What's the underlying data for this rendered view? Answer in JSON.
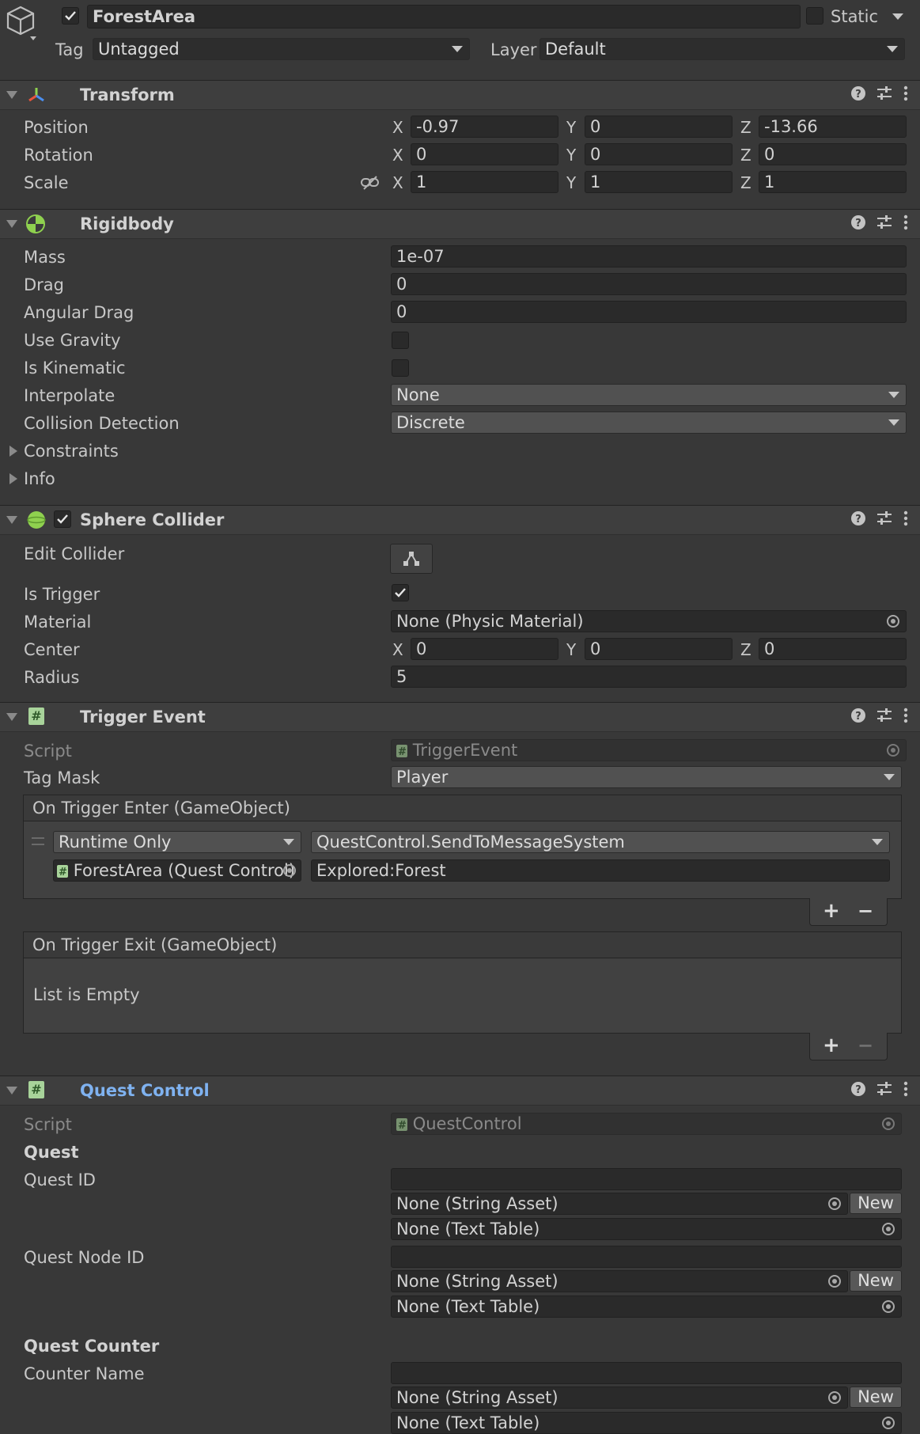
{
  "object": {
    "name": "ForestArea",
    "active": true,
    "static_label": "Static",
    "static": false,
    "tag_label": "Tag",
    "tag_value": "Untagged",
    "layer_label": "Layer",
    "layer_value": "Default"
  },
  "transform": {
    "title": "Transform",
    "position_label": "Position",
    "rotation_label": "Rotation",
    "scale_label": "Scale",
    "axis_x": "X",
    "axis_y": "Y",
    "axis_z": "Z",
    "position": {
      "x": "-0.97",
      "y": "0",
      "z": "-13.66"
    },
    "rotation": {
      "x": "0",
      "y": "0",
      "z": "0"
    },
    "scale": {
      "x": "1",
      "y": "1",
      "z": "1"
    }
  },
  "rigidbody": {
    "title": "Rigidbody",
    "mass_label": "Mass",
    "mass": "1e-07",
    "drag_label": "Drag",
    "drag": "0",
    "angular_drag_label": "Angular Drag",
    "angular_drag": "0",
    "use_gravity_label": "Use Gravity",
    "use_gravity": false,
    "is_kinematic_label": "Is Kinematic",
    "is_kinematic": false,
    "interpolate_label": "Interpolate",
    "interpolate": "None",
    "collision_label": "Collision Detection",
    "collision": "Discrete",
    "constraints_label": "Constraints",
    "info_label": "Info"
  },
  "sphere_collider": {
    "title": "Sphere Collider",
    "enabled": true,
    "edit_label": "Edit Collider",
    "is_trigger_label": "Is Trigger",
    "is_trigger": true,
    "material_label": "Material",
    "material": "None (Physic Material)",
    "center_label": "Center",
    "center": {
      "x": "0",
      "y": "0",
      "z": "0"
    },
    "radius_label": "Radius",
    "radius": "5"
  },
  "trigger_event": {
    "title": "Trigger Event",
    "script_label": "Script",
    "script": "TriggerEvent",
    "tag_mask_label": "Tag Mask",
    "tag_mask": "Player",
    "enter_header": "On Trigger Enter (GameObject)",
    "enter_runtime": "Runtime Only",
    "enter_function": "QuestControl.SendToMessageSystem",
    "enter_target": "ForestArea (Quest Control)",
    "enter_arg": "Explored:Forest",
    "exit_header": "On Trigger Exit (GameObject)",
    "exit_empty": "List is Empty",
    "plus": "+",
    "minus": "−"
  },
  "quest_control": {
    "title": "Quest Control",
    "script_label": "Script",
    "script": "QuestControl",
    "quest_header": "Quest",
    "quest_id_label": "Quest ID",
    "quest_node_id_label": "Quest Node ID",
    "quest_counter_header": "Quest Counter",
    "counter_name_label": "Counter Name",
    "string_asset": "None (String Asset)",
    "text_table": "None (Text Table)",
    "new_label": "New"
  },
  "colors": {
    "background": "#383838",
    "field": "#2a2a2a",
    "link_title": "#7fb2f0"
  }
}
